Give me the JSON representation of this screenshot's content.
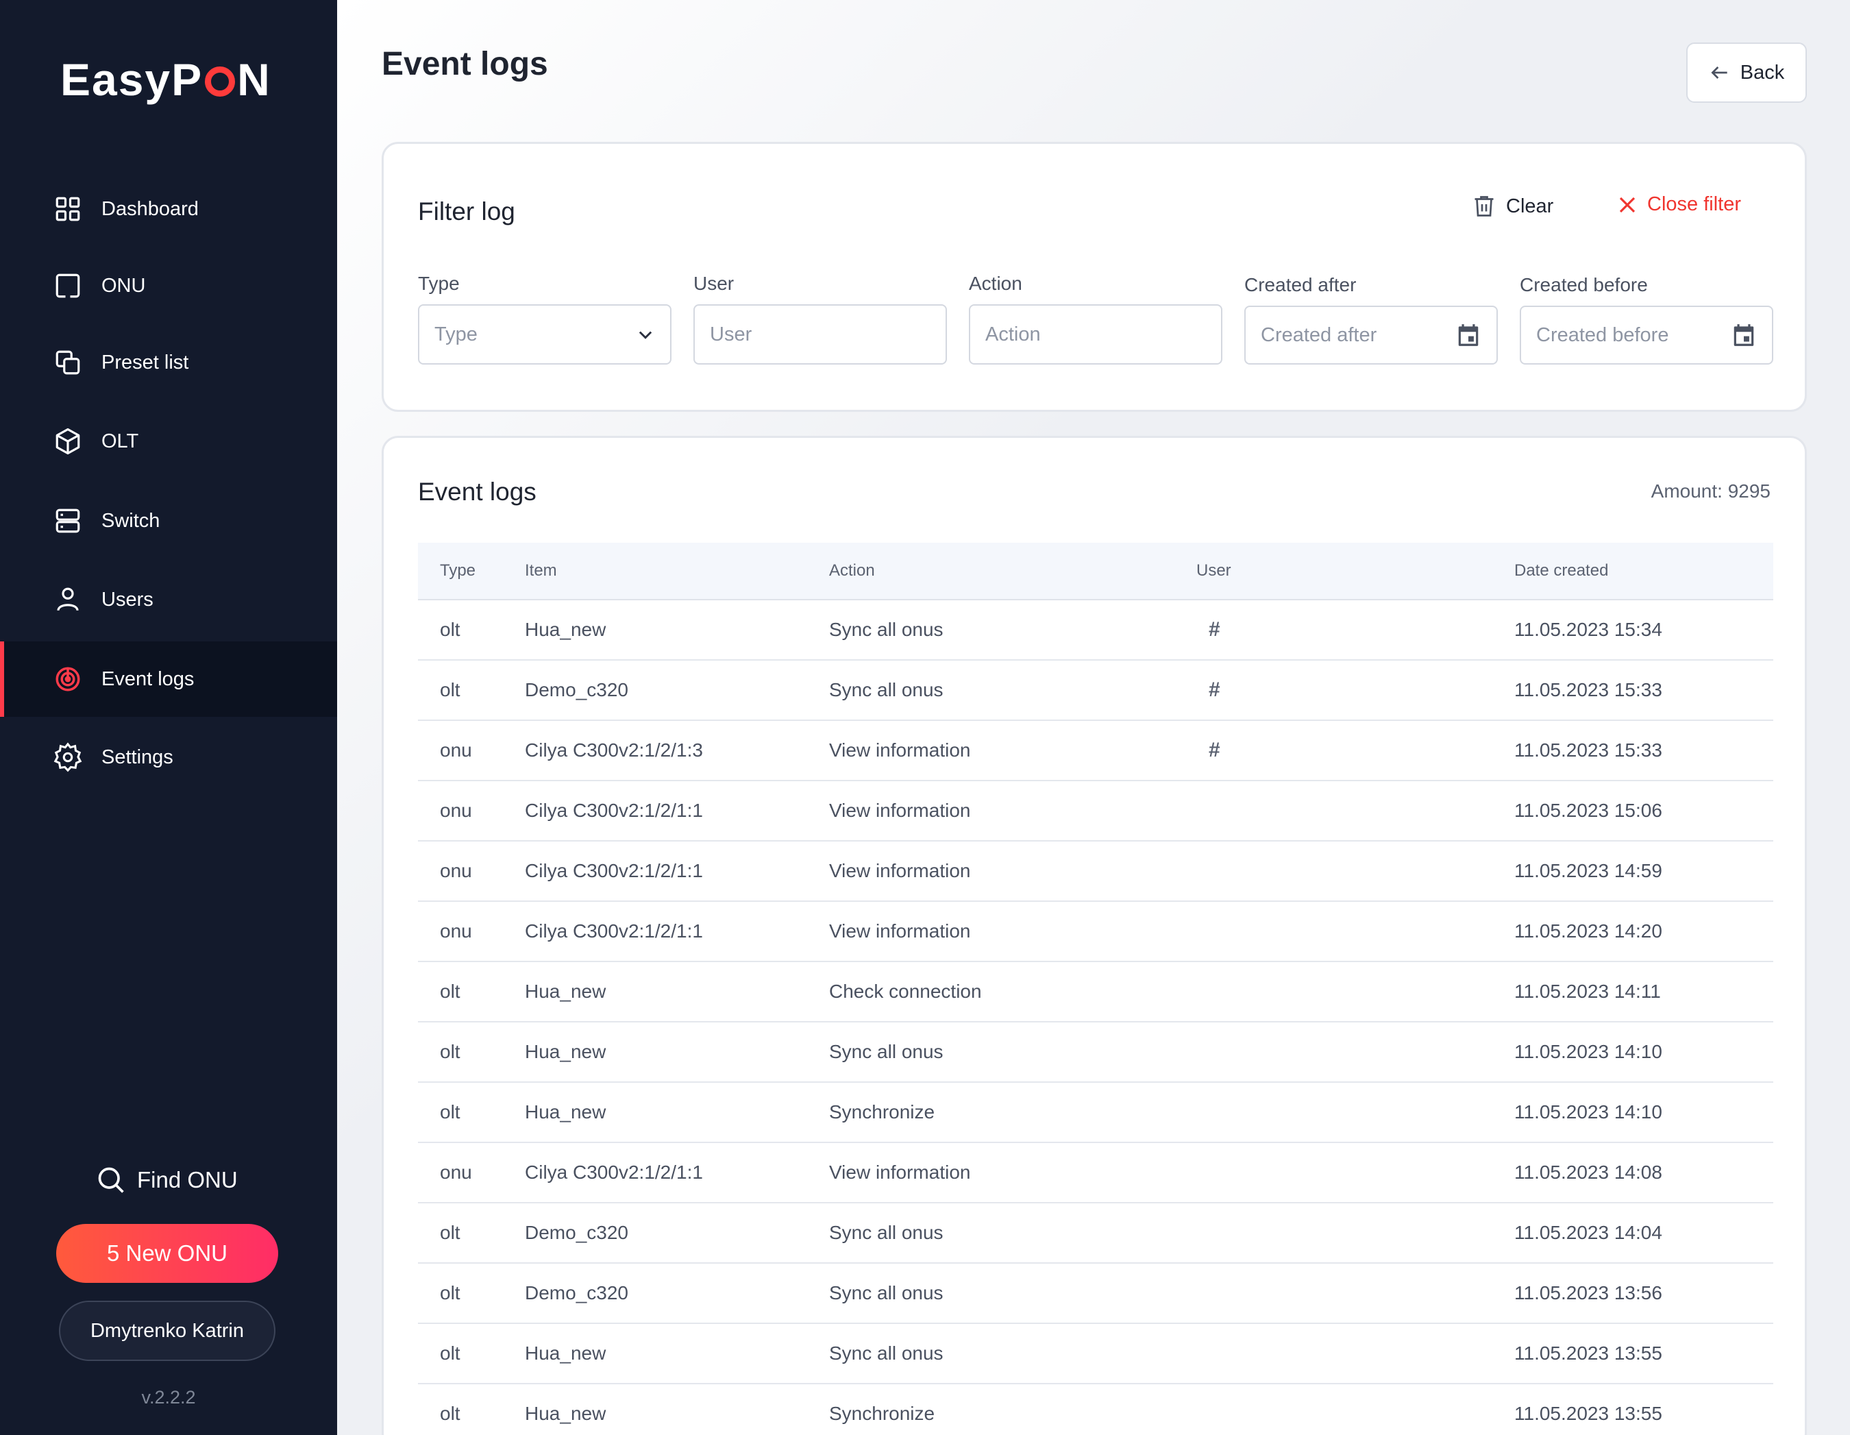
{
  "sidebar": {
    "logo_left": "EasyP",
    "logo_right": "N",
    "nav": [
      {
        "label": "Dashboard",
        "icon": "dashboard-icon",
        "active": false
      },
      {
        "label": "ONU",
        "icon": "onu-icon",
        "active": false
      },
      {
        "label": "Preset list",
        "icon": "copy-icon",
        "active": false
      },
      {
        "label": "OLT",
        "icon": "cube-icon",
        "active": false
      },
      {
        "label": "Switch",
        "icon": "server-icon",
        "active": false
      },
      {
        "label": "Users",
        "icon": "user-icon",
        "active": false
      },
      {
        "label": "Event logs",
        "icon": "radar-icon",
        "active": true
      },
      {
        "label": "Settings",
        "icon": "gear-icon",
        "active": false
      }
    ],
    "find_onu": "Find ONU",
    "new_onu": "5 New ONU",
    "user_name": "Dmytrenko Katrin",
    "version": "v.2.2.2"
  },
  "header": {
    "title": "Event logs",
    "back_label": "Back"
  },
  "filter": {
    "title": "Filter log",
    "clear_label": "Clear",
    "close_label": "Close filter",
    "fields": {
      "type": {
        "label": "Type",
        "placeholder": "Type"
      },
      "user": {
        "label": "User",
        "placeholder": "User"
      },
      "action": {
        "label": "Action",
        "placeholder": "Action"
      },
      "created_after": {
        "label": "Created after",
        "placeholder": "Created after"
      },
      "created_before": {
        "label": "Created before",
        "placeholder": "Created before"
      }
    }
  },
  "logs": {
    "title": "Event logs",
    "amount": "Amount: 9295",
    "columns": {
      "type": "Type",
      "item": "Item",
      "action": "Action",
      "user": "User",
      "date": "Date created"
    },
    "rows": [
      {
        "type": "olt",
        "item": "Hua_new",
        "action": "Sync all onus",
        "user": "#",
        "date": "11.05.2023 15:34"
      },
      {
        "type": "olt",
        "item": "Demo_c320",
        "action": "Sync all onus",
        "user": "#",
        "date": "11.05.2023 15:33"
      },
      {
        "type": "onu",
        "item": "Cilya C300v2:1/2/1:3",
        "action": "View information",
        "user": "#",
        "date": "11.05.2023 15:33"
      },
      {
        "type": "onu",
        "item": "Cilya C300v2:1/2/1:1",
        "action": "View information",
        "user": "",
        "date": "11.05.2023 15:06"
      },
      {
        "type": "onu",
        "item": "Cilya C300v2:1/2/1:1",
        "action": "View information",
        "user": "",
        "date": "11.05.2023 14:59"
      },
      {
        "type": "onu",
        "item": "Cilya C300v2:1/2/1:1",
        "action": "View information",
        "user": "",
        "date": "11.05.2023 14:20"
      },
      {
        "type": "olt",
        "item": "Hua_new",
        "action": "Check connection",
        "user": "",
        "date": "11.05.2023 14:11"
      },
      {
        "type": "olt",
        "item": "Hua_new",
        "action": "Sync all onus",
        "user": "",
        "date": "11.05.2023 14:10"
      },
      {
        "type": "olt",
        "item": "Hua_new",
        "action": "Synchronize",
        "user": "",
        "date": "11.05.2023 14:10"
      },
      {
        "type": "onu",
        "item": "Cilya C300v2:1/2/1:1",
        "action": "View information",
        "user": "",
        "date": "11.05.2023 14:08"
      },
      {
        "type": "olt",
        "item": "Demo_c320",
        "action": "Sync all onus",
        "user": "",
        "date": "11.05.2023 14:04"
      },
      {
        "type": "olt",
        "item": "Demo_c320",
        "action": "Sync all onus",
        "user": "",
        "date": "11.05.2023 13:56"
      },
      {
        "type": "olt",
        "item": "Hua_new",
        "action": "Sync all onus",
        "user": "",
        "date": "11.05.2023 13:55"
      },
      {
        "type": "olt",
        "item": "Hua_new",
        "action": "Synchronize",
        "user": "",
        "date": "11.05.2023 13:55"
      }
    ]
  },
  "colors": {
    "accent": "#ff3b4a",
    "sidebar_bg": "#131a2c",
    "danger": "#f0352f"
  }
}
